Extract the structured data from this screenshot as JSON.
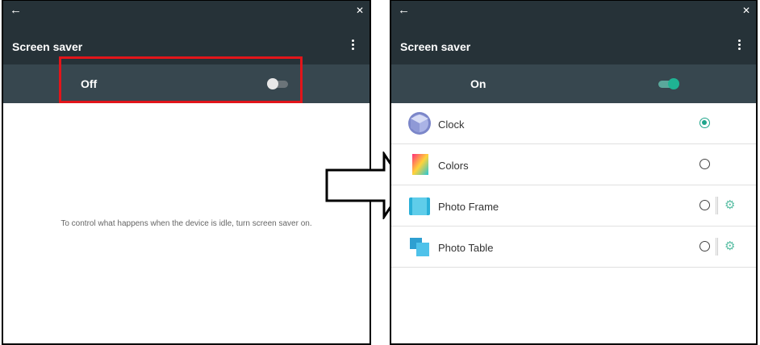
{
  "left_screen": {
    "title": "Screen saver",
    "switch_label": "Off",
    "switch_state": "off",
    "empty_message": "To control what happens when the device is idle, turn screen saver on.",
    "highlight_color": "#e2151a"
  },
  "right_screen": {
    "title": "Screen saver",
    "switch_label": "On",
    "switch_state": "on",
    "items": [
      {
        "label": "Clock",
        "selected": true,
        "has_settings": false
      },
      {
        "label": "Colors",
        "selected": false,
        "has_settings": false
      },
      {
        "label": "Photo Frame",
        "selected": false,
        "has_settings": true
      },
      {
        "label": "Photo Table",
        "selected": false,
        "has_settings": true
      }
    ]
  },
  "icons": {
    "back": "arrow-left-icon",
    "close": "close-icon",
    "menu": "more-vert-icon",
    "settings": "gear-icon"
  },
  "colors": {
    "toolbar": "#263238",
    "switch_bar": "#37474f",
    "accent": "#1fb393"
  }
}
